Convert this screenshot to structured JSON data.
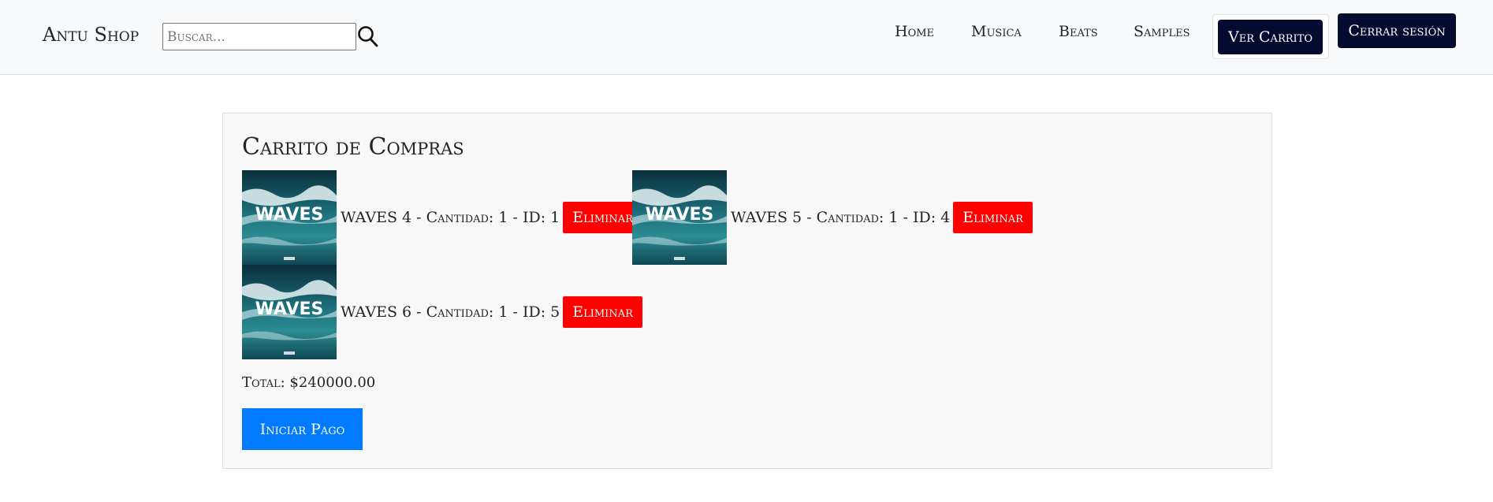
{
  "header": {
    "brand": "Antu Shop",
    "search": {
      "placeholder": "Buscar...",
      "value": ""
    },
    "nav": [
      "Home",
      "Musica",
      "Beats",
      "Samples"
    ],
    "cart_button": "Ver Carrito",
    "logout_button": "Cerrar sesión"
  },
  "cart": {
    "title": "Carrito de Compras",
    "items": [
      {
        "text": "WAVES 4 - Cantidad: 1 - ID: 1",
        "remove_label": "Eliminar",
        "cover_text": "WAVES"
      },
      {
        "text": "WAVES 5 - Cantidad: 1 - ID: 4",
        "remove_label": "Eliminar",
        "cover_text": "WAVES"
      },
      {
        "text": "WAVES 6 - Cantidad: 1 - ID: 5",
        "remove_label": "Eliminar",
        "cover_text": "WAVES"
      }
    ],
    "total": "Total: $240000.00",
    "pay_button": "Iniciar Pago"
  },
  "colors": {
    "navbar_bg": "#f8f9fa",
    "dark_button": "#050a30",
    "remove_button": "#ff0000",
    "pay_button": "#007bff"
  }
}
